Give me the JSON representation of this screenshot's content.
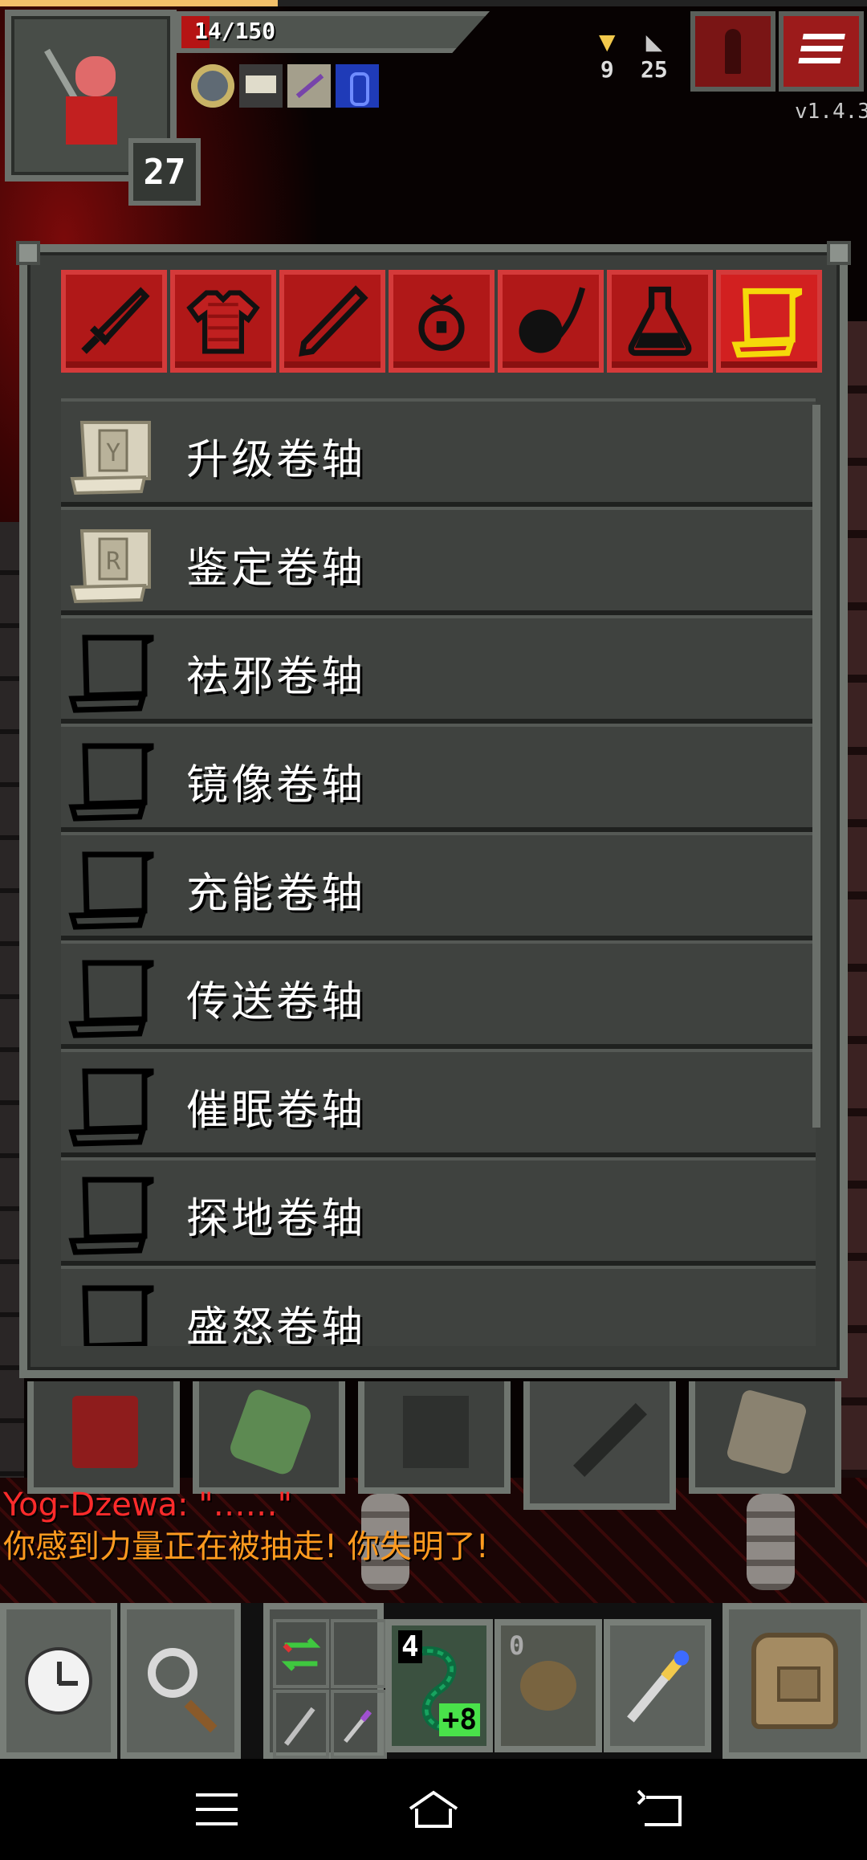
{
  "status": {
    "hp_text": "14/150",
    "hp_fraction": 0.093,
    "xp_fraction": 0.32,
    "hero_level": "27",
    "gold": "9",
    "depth": "25",
    "version": "v1.4.3"
  },
  "inventory": {
    "tabs": [
      {
        "icon": "sword-icon",
        "active": false
      },
      {
        "icon": "armor-icon",
        "active": false
      },
      {
        "icon": "wand-icon",
        "active": false
      },
      {
        "icon": "ring-icon",
        "active": false
      },
      {
        "icon": "artifact-icon",
        "active": false
      },
      {
        "icon": "potion-icon",
        "active": false
      },
      {
        "icon": "scroll-icon",
        "active": true
      }
    ],
    "items": [
      {
        "label": "升级卷轴",
        "known": true,
        "rune": "Y"
      },
      {
        "label": "鉴定卷轴",
        "known": true,
        "rune": "R"
      },
      {
        "label": "祛邪卷轴",
        "known": false,
        "rune": ""
      },
      {
        "label": "镜像卷轴",
        "known": false,
        "rune": ""
      },
      {
        "label": "充能卷轴",
        "known": false,
        "rune": ""
      },
      {
        "label": "传送卷轴",
        "known": false,
        "rune": ""
      },
      {
        "label": "催眠卷轴",
        "known": false,
        "rune": ""
      },
      {
        "label": "探地卷轴",
        "known": false,
        "rune": ""
      },
      {
        "label": "盛怒卷轴",
        "known": false,
        "rune": ""
      }
    ]
  },
  "log": {
    "line1": "Yog-Dzewa: \"……\"",
    "line2": "你感到力量正在被抽走!  你失明了!"
  },
  "quickslots": {
    "slot1_count": "4",
    "slot1_upgrade": "+8",
    "slot2_count": "0"
  },
  "colors": {
    "tab_red": "#b01818",
    "active_outline": "#f5d90a",
    "log_red": "#ff2b2b",
    "log_orange": "#ff9a1f",
    "hp_red": "#b51414"
  }
}
